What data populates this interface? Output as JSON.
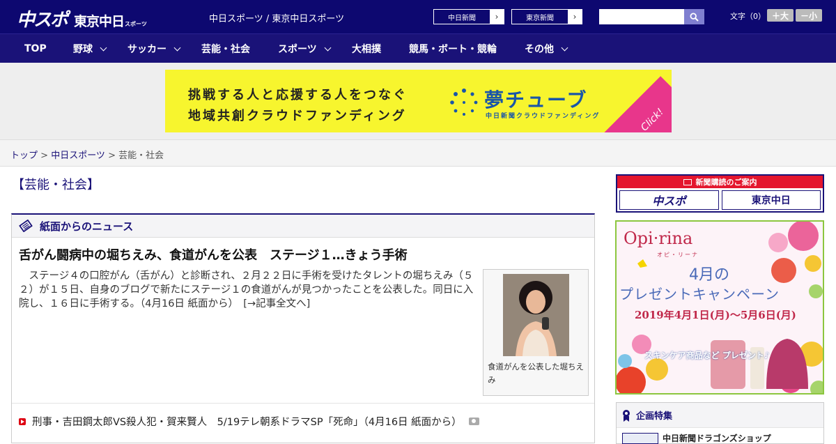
{
  "header": {
    "logo_main": "中スポ",
    "logo_tokyo": "東京中日",
    "logo_sports": "スポーツ",
    "site_title": "中日スポーツ / 東京中日スポーツ",
    "paper_links": [
      {
        "label": "中日新聞"
      },
      {
        "label": "東京新聞"
      }
    ],
    "search_placeholder": "",
    "font_size_label": "文字（0）",
    "font_larger": "＋大",
    "font_smaller": "－小"
  },
  "nav": {
    "items": [
      {
        "label": "TOP",
        "has_menu": false
      },
      {
        "label": "野球",
        "has_menu": true
      },
      {
        "label": "サッカー",
        "has_menu": true
      },
      {
        "label": "芸能・社会",
        "has_menu": false
      },
      {
        "label": "スポーツ",
        "has_menu": true
      },
      {
        "label": "大相撲",
        "has_menu": false
      },
      {
        "label": "競馬・ボート・競輪",
        "has_menu": false
      },
      {
        "label": "その他",
        "has_menu": true
      }
    ]
  },
  "banner": {
    "line1": "挑戦する人と応援する人をつなぐ",
    "line2": "地域共創クラウドファンディング",
    "brand": "夢チューブ",
    "brand_sub": "中日新聞クラウドファンディング",
    "click": "Click!"
  },
  "breadcrumb": {
    "home": "トップ",
    "sep": " > ",
    "level1": "中日スポーツ",
    "current": "芸能・社会"
  },
  "section_title": "【芸能・社会】",
  "news_panel": {
    "title": "紙面からのニュース",
    "headline": "舌がん闘病中の堀ちえみ、食道がんを公表　ステージ１…きょう手術",
    "body": "　ステージ４の口腔がん（舌がん）と診断され、２月２２日に手術を受けたタレントの堀ちえみ（５２）が１５日、自身のブログで新たにステージ１の食道がんが見つかったことを公表した。同日に入院し、１６日に手術する。（4月16日 紙面から）　",
    "read_more": "[→記事全文へ]",
    "photo_caption": "食道がんを公表した堀ちえみ",
    "list": [
      {
        "text": "刑事・吉田鋼太郎VS殺人犯・賀来賢人　5/19テレ朝系ドラマSP「死命」（4月16日 紙面から）"
      }
    ]
  },
  "sidebar": {
    "subscribe_head": "新聞購読のご案内",
    "subscribe_logo_a": "中スポ",
    "subscribe_logo_b": "東京中日",
    "ad_brand": "Opi·rina",
    "ad_brand_sub": "オピ・リーナ",
    "ad_month": "4月の",
    "ad_title": "プレゼントキャンペーン",
    "ad_date": "2019年4月1日(月)〜5月6日(月)",
    "ad_promo": "スキンケア商品など プレゼント♪",
    "feature_title": "企画特集",
    "feature_item": "中日新聞ドラゴンズショップ"
  },
  "colors": {
    "header_bg": "#0d0870",
    "nav_bg": "#1a1278",
    "accent_red": "#e4162e",
    "banner_yellow": "#f7f52e"
  }
}
